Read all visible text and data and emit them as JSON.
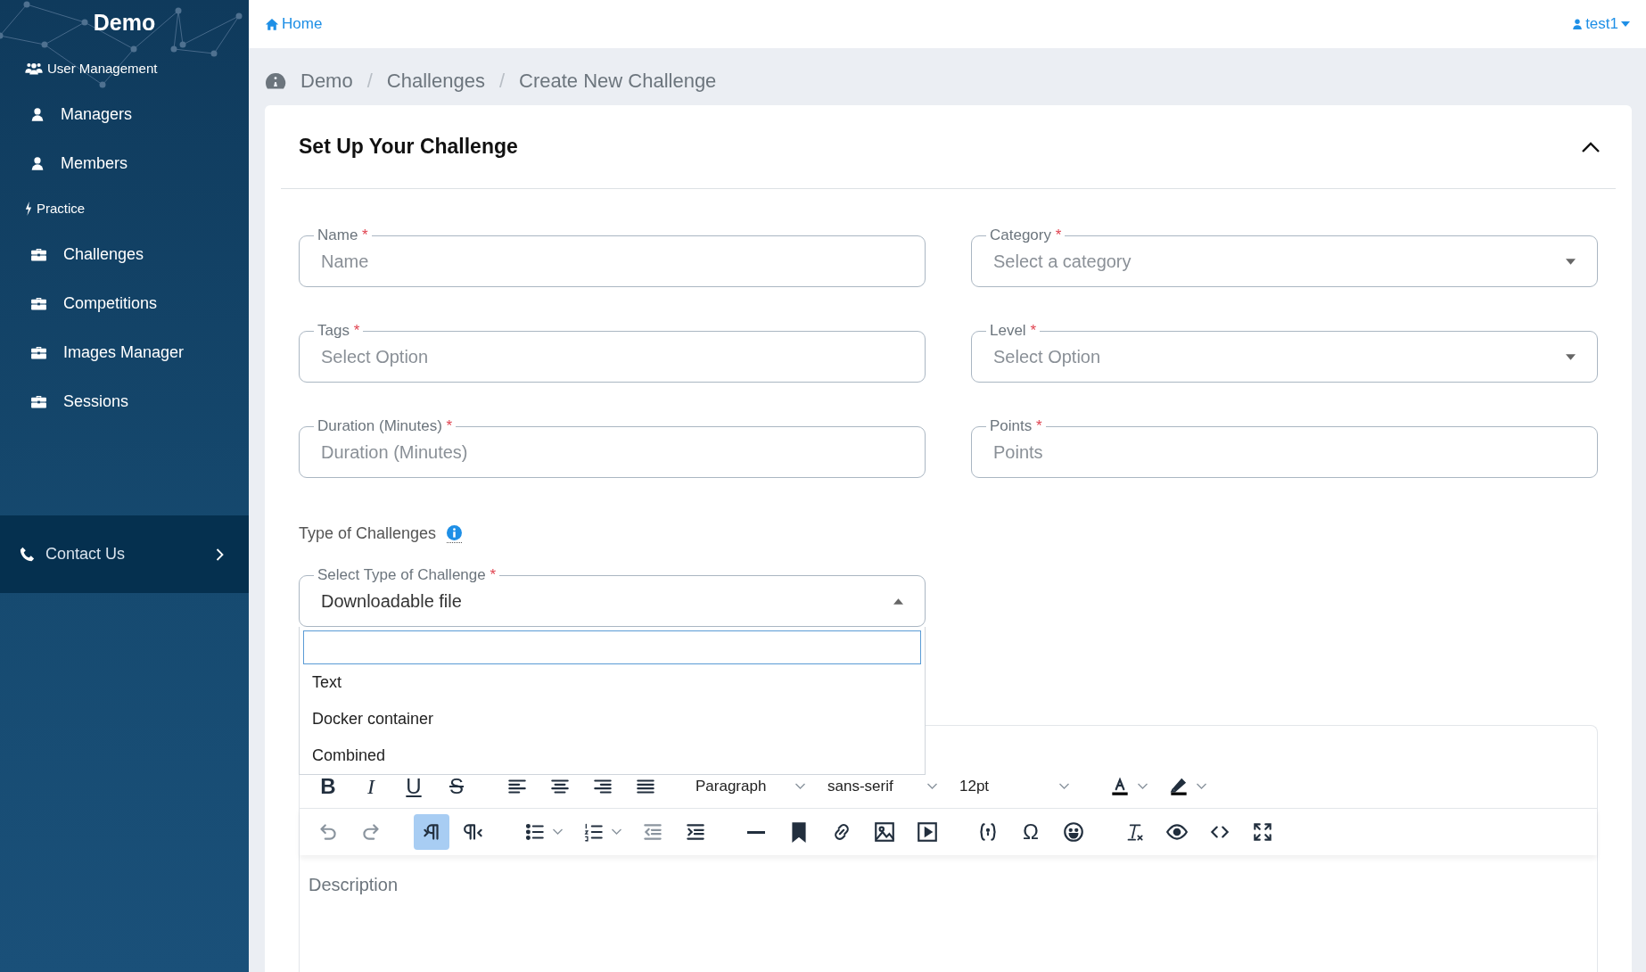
{
  "sidebar": {
    "brand": "Demo",
    "sections": [
      {
        "title": "User Management",
        "items": [
          {
            "label": "Managers"
          },
          {
            "label": "Members"
          }
        ]
      },
      {
        "title": "Practice",
        "items": [
          {
            "label": "Challenges"
          },
          {
            "label": "Competitions"
          },
          {
            "label": "Images Manager"
          },
          {
            "label": "Sessions"
          }
        ]
      }
    ],
    "contact": {
      "label": "Contact Us"
    }
  },
  "topbar": {
    "home": "Home",
    "user": "test1"
  },
  "breadcrumb": [
    {
      "label": "Demo"
    },
    {
      "separator": "/",
      "label": "Challenges"
    },
    {
      "separator": "/",
      "label": "Create New Challenge"
    }
  ],
  "card": {
    "title": "Set Up Your Challenge",
    "expanded": true,
    "fields": [
      {
        "label": "Name",
        "required": "*",
        "placeholder": "Name",
        "kind": "text"
      },
      {
        "label": "Category",
        "required": "*",
        "placeholder": "Select a category",
        "kind": "select"
      },
      {
        "label": "Tags",
        "required": "*",
        "placeholder": "Select Option",
        "kind": "text"
      },
      {
        "label": "Level",
        "required": "*",
        "placeholder": "Select Option",
        "kind": "select"
      },
      {
        "label": "Duration (Minutes)",
        "required": "*",
        "placeholder": "Duration (Minutes)",
        "kind": "text"
      },
      {
        "label": "Points",
        "required": "*",
        "placeholder": "Points",
        "kind": "text"
      }
    ],
    "type_heading": "Type of Challenges",
    "type_select": {
      "label": "Select Type of Challenge",
      "required": "*",
      "value": "Downloadable file",
      "expanded": true,
      "options": [
        {
          "label": "Text"
        },
        {
          "label": "Docker container"
        },
        {
          "label": "Combined"
        }
      ]
    },
    "editor": {
      "placeholder": "Description",
      "toolbar_rows": [
        {
          "groups": [
            [
              {
                "kind": "bold",
                "glyph": "B",
                "active": false
              },
              {
                "kind": "italic",
                "glyph": "I",
                "active": false
              },
              {
                "kind": "underline",
                "glyph": "U",
                "active": false
              },
              {
                "kind": "strike",
                "glyph": "S",
                "active": false
              }
            ],
            [
              {
                "kind": "align-left",
                "active": false
              },
              {
                "kind": "align-center",
                "active": false
              },
              {
                "kind": "align-right",
                "active": false
              },
              {
                "kind": "justify",
                "active": false
              }
            ],
            [
              {
                "kind": "menu",
                "label": "Paragraph"
              },
              {
                "kind": "menu",
                "label": "sans-serif"
              },
              {
                "kind": "menu",
                "label": "12pt"
              }
            ],
            [
              {
                "kind": "text-color",
                "active": false
              },
              {
                "kind": "highlight",
                "active": false
              }
            ]
          ]
        },
        {
          "groups": [
            [
              {
                "kind": "undo",
                "active": false
              },
              {
                "kind": "redo",
                "active": false
              }
            ],
            [
              {
                "kind": "ltr",
                "active": true
              },
              {
                "kind": "rtl",
                "active": false
              }
            ],
            [
              {
                "kind": "bullet-list",
                "active": false
              },
              {
                "kind": "number-list",
                "active": false
              },
              {
                "kind": "outdent",
                "active": false
              },
              {
                "kind": "indent",
                "active": false
              }
            ],
            [
              {
                "kind": "hr",
                "active": false
              },
              {
                "kind": "bookmark",
                "active": false
              },
              {
                "kind": "link",
                "active": false
              },
              {
                "kind": "image",
                "active": false
              },
              {
                "kind": "media",
                "active": false
              }
            ],
            [
              {
                "kind": "code-sample",
                "active": false
              },
              {
                "kind": "omega",
                "glyph": "Ω",
                "active": false
              },
              {
                "kind": "emoji",
                "active": false
              }
            ],
            [
              {
                "kind": "clear-format",
                "active": false
              },
              {
                "kind": "preview",
                "active": false
              },
              {
                "kind": "code",
                "active": false
              },
              {
                "kind": "fullscreen",
                "active": false
              }
            ]
          ]
        }
      ]
    }
  }
}
